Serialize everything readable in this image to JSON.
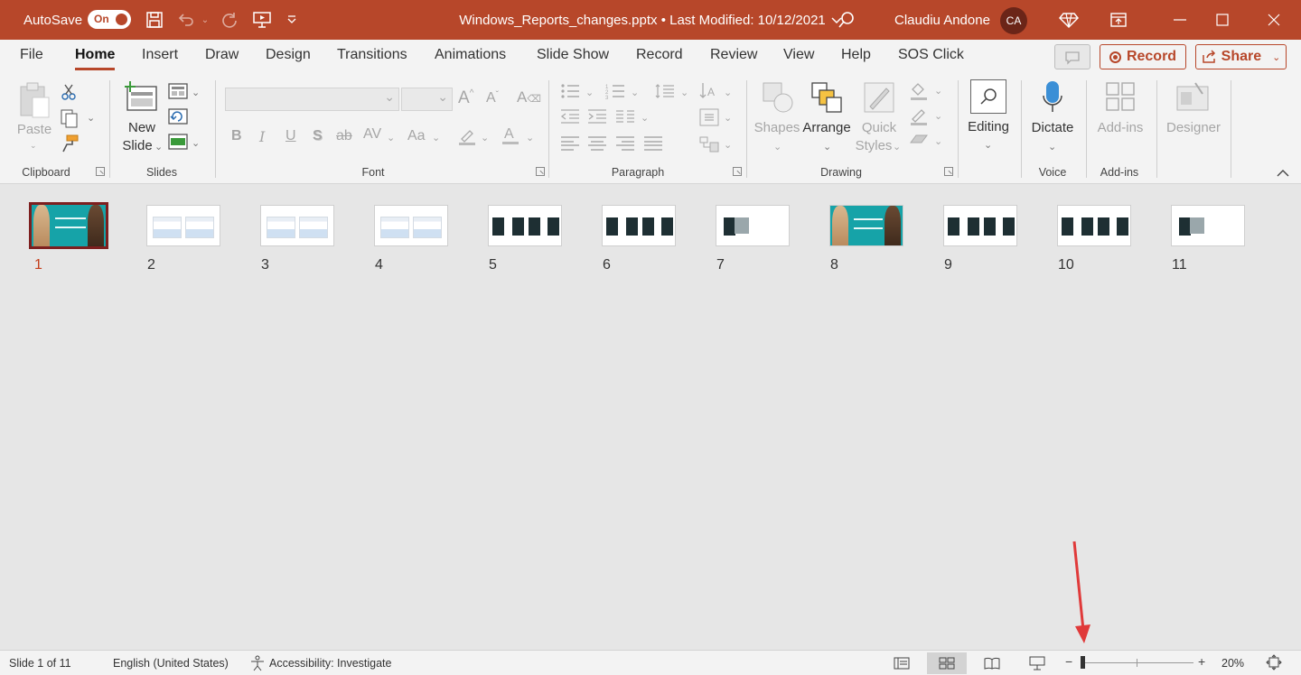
{
  "titlebar": {
    "autosave_label": "AutoSave",
    "autosave_state": "On",
    "document_title": "Windows_Reports_changes.pptx • Last Modified: 10/12/2021",
    "user_name": "Claudiu Andone",
    "user_initials": "CA",
    "bg_color": "#b7472a"
  },
  "ribbon": {
    "tabs": [
      "File",
      "Home",
      "Insert",
      "Draw",
      "Design",
      "Transitions",
      "Animations",
      "Slide Show",
      "Record",
      "Review",
      "View",
      "Help",
      "SOS Click"
    ],
    "active_tab": "Home",
    "record_label": "Record",
    "share_label": "Share",
    "clipboard": {
      "paste_label": "Paste",
      "group_label": "Clipboard"
    },
    "slides": {
      "new_slide_label_1": "New",
      "new_slide_label_2": "Slide",
      "group_label": "Slides"
    },
    "font": {
      "group_label": "Font",
      "font_name": "",
      "font_size": ""
    },
    "paragraph": {
      "group_label": "Paragraph"
    },
    "drawing": {
      "shapes_label": "Shapes",
      "arrange_label": "Arrange",
      "quick_styles_label_1": "Quick",
      "quick_styles_label_2": "Styles",
      "group_label": "Drawing"
    },
    "editing": {
      "label": "Editing"
    },
    "voice": {
      "dictate_label": "Dictate",
      "group_label": "Voice"
    },
    "addins": {
      "label": "Add-ins",
      "group_label": "Add-ins"
    },
    "designer": {
      "label": "Designer"
    }
  },
  "slides": [
    {
      "num": "1",
      "kind": "photo",
      "selected": true
    },
    {
      "num": "2",
      "kind": "screens"
    },
    {
      "num": "3",
      "kind": "screens"
    },
    {
      "num": "4",
      "kind": "screens"
    },
    {
      "num": "5",
      "kind": "blocks"
    },
    {
      "num": "6",
      "kind": "blocks"
    },
    {
      "num": "7",
      "kind": "single"
    },
    {
      "num": "8",
      "kind": "photo"
    },
    {
      "num": "9",
      "kind": "blocks"
    },
    {
      "num": "10",
      "kind": "blocks"
    },
    {
      "num": "11",
      "kind": "single"
    }
  ],
  "statusbar": {
    "slide_info": "Slide 1 of 11",
    "language": "English (United States)",
    "accessibility": "Accessibility: Investigate",
    "zoom": "20%",
    "zoom_fraction": 0.0
  },
  "annotation": {
    "color": "#e03a3a",
    "target": "zoom-slider"
  }
}
